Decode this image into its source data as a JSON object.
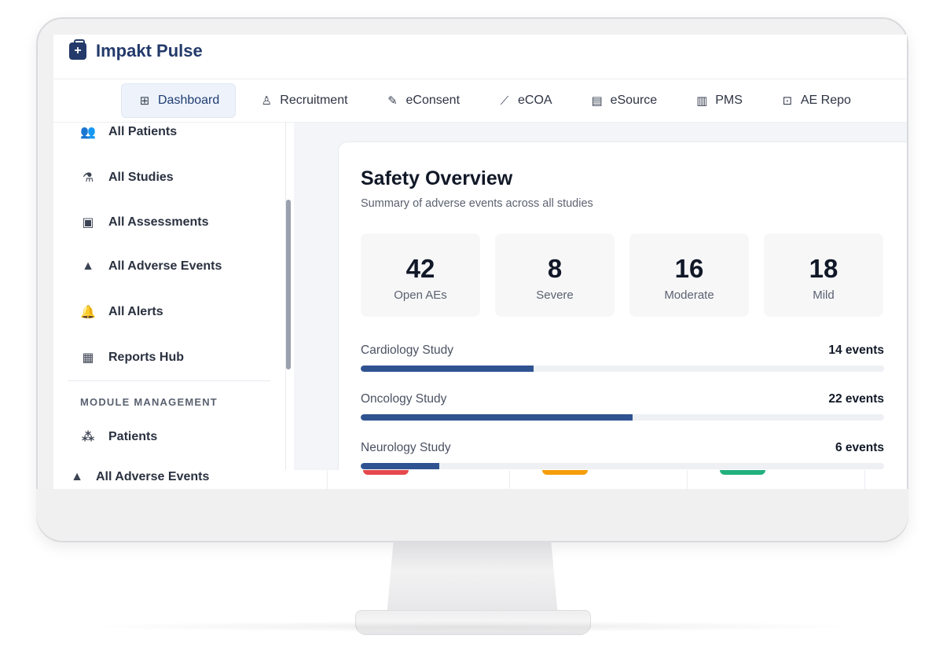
{
  "app": {
    "brand_name": "Impakt Pulse"
  },
  "tabs": [
    {
      "label": "Dashboard",
      "icon": "grid-icon",
      "active": true
    },
    {
      "label": "Recruitment",
      "icon": "users-icon"
    },
    {
      "label": "eConsent",
      "icon": "edit-doc-icon"
    },
    {
      "label": "eCOA",
      "icon": "line-chart-icon"
    },
    {
      "label": "eSource",
      "icon": "document-icon"
    },
    {
      "label": "PMS",
      "icon": "bar-chart-icon"
    },
    {
      "label": "AE Repo",
      "icon": "activity-icon"
    }
  ],
  "sidebar": {
    "items": [
      {
        "label": "All Patients",
        "icon": "people-icon"
      },
      {
        "label": "All Studies",
        "icon": "flask-icon"
      },
      {
        "label": "All Assessments",
        "icon": "clipboard-icon"
      },
      {
        "label": "All Adverse Events",
        "icon": "warning-icon"
      },
      {
        "label": "All Alerts",
        "icon": "bell-icon"
      },
      {
        "label": "Reports Hub",
        "icon": "report-icon"
      }
    ],
    "section_title": "MODULE MANAGEMENT",
    "module_items": [
      {
        "label": "Patients",
        "icon": "group-icon"
      }
    ],
    "overlay_item": {
      "label": "All Adverse Events",
      "icon": "warning-icon"
    }
  },
  "safety": {
    "title": "Safety Overview",
    "subtitle": "Summary of adverse events across all studies",
    "stats": [
      {
        "value": "42",
        "label": "Open AEs"
      },
      {
        "value": "8",
        "label": "Severe"
      },
      {
        "value": "16",
        "label": "Moderate"
      },
      {
        "value": "18",
        "label": "Mild"
      }
    ],
    "studies": [
      {
        "name": "Cardiology Study",
        "count": "14 events",
        "progress": 0.33
      },
      {
        "name": "Oncology Study",
        "count": "22 events",
        "progress": 0.52
      },
      {
        "name": "Neurology Study",
        "count": "6 events",
        "progress": 0.15
      }
    ]
  },
  "colors": {
    "brand_dark": "#233a6b",
    "brand_light": "#2196c9",
    "progress": "#2f5391",
    "pill_red": "#e5484d",
    "pill_orange": "#f59e0b",
    "pill_green": "#22b07d"
  }
}
